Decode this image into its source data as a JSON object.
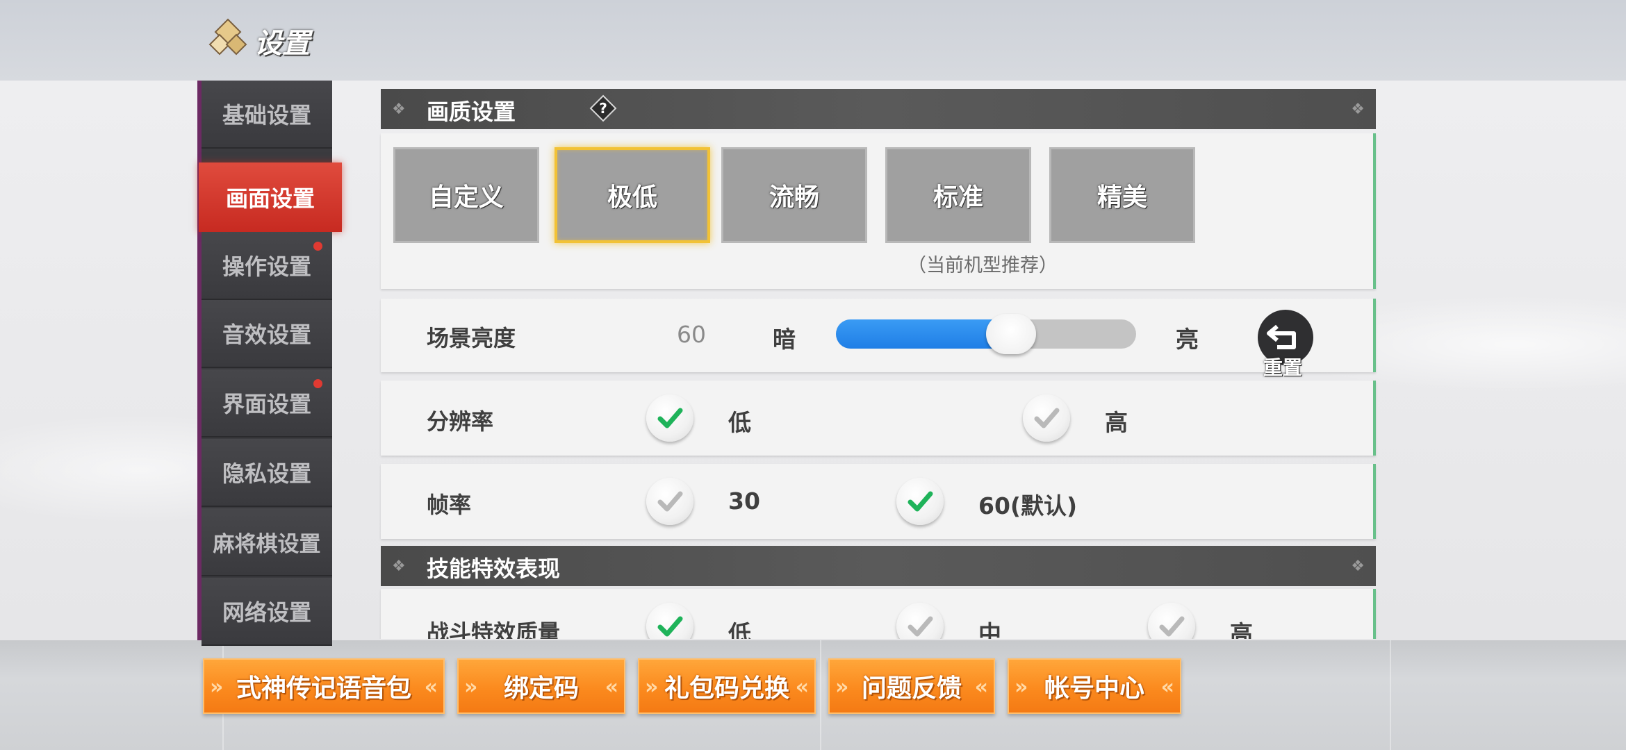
{
  "header": {
    "title": "设置"
  },
  "sidebar": {
    "items": [
      {
        "label": "基础设置"
      },
      {
        "label": "画面设置"
      },
      {
        "label": "操作设置"
      },
      {
        "label": "音效设置"
      },
      {
        "label": "界面设置"
      },
      {
        "label": "隐私设置"
      },
      {
        "label": "麻将棋设置"
      },
      {
        "label": "网络设置"
      }
    ],
    "active_item": "画面设置"
  },
  "quality_section": {
    "title": "画质设置",
    "help_icon": "question-diamond-icon",
    "presets": [
      "自定义",
      "极低",
      "流畅",
      "标准",
      "精美"
    ],
    "selected_preset": "极低",
    "recommend_note": "（当前机型推荐）"
  },
  "brightness": {
    "label": "场景亮度",
    "value": "60",
    "min_label": "暗",
    "max_label": "亮",
    "level_fraction": 0.6,
    "reset_label": "重置"
  },
  "resolution": {
    "label": "分辨率",
    "options": [
      {
        "label": "低",
        "checked": true
      },
      {
        "label": "高",
        "checked": false
      }
    ]
  },
  "framerate": {
    "label": "帧率",
    "options": [
      {
        "label": "30",
        "checked": false
      },
      {
        "label": "60(默认)",
        "checked": true
      }
    ]
  },
  "skill_section": {
    "title": "技能特效表现",
    "effect_quality": {
      "label": "战斗特效质量",
      "options": [
        {
          "label": "低",
          "checked": true
        },
        {
          "label": "中",
          "checked": false
        },
        {
          "label": "高",
          "checked": false
        }
      ]
    }
  },
  "bottom_buttons": [
    "式神传记语音包",
    "绑定码",
    "礼包码兑换",
    "问题反馈",
    "帐号中心"
  ],
  "colors": {
    "accent_red": "#d43528",
    "check_green": "#1fb35a",
    "slider_blue": "#2a8cf0",
    "button_orange": "#fb8a1e"
  }
}
